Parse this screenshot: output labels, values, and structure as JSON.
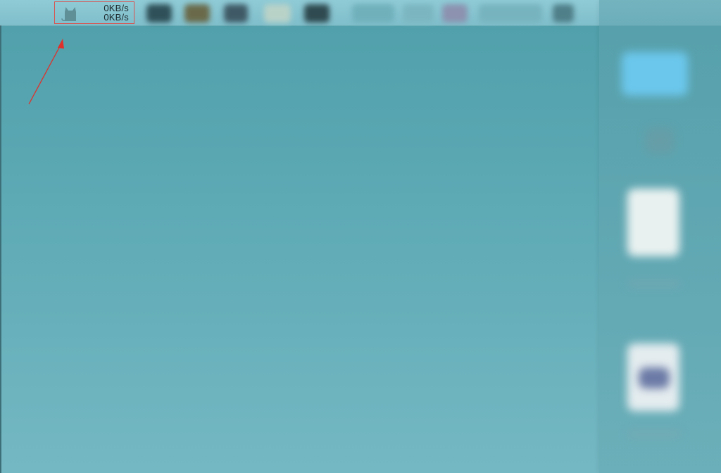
{
  "menubar": {
    "network_monitor": {
      "upload_speed": "0KB/s",
      "download_speed": "0KB/s",
      "icon": "cat-icon"
    }
  },
  "annotation": {
    "arrow_color": "#e0302b",
    "highlight_color": "#d9534f"
  },
  "colors": {
    "desktop_background": "#5eaab5",
    "menubar_background": "#8fcbd6"
  }
}
